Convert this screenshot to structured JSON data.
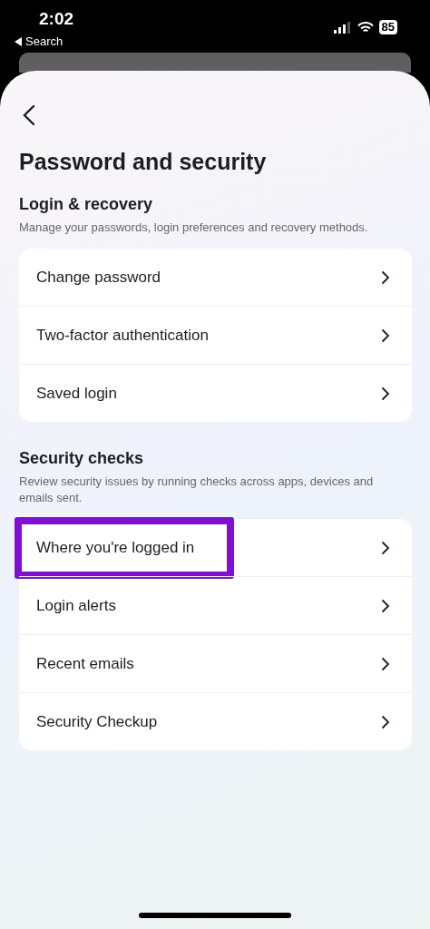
{
  "status_bar": {
    "time": "2:02",
    "back_label": "Search",
    "battery": "85"
  },
  "title": "Password and security",
  "sections": [
    {
      "heading": "Login & recovery",
      "description": "Manage your passwords, login preferences and recovery methods.",
      "items": [
        {
          "label": "Change password",
          "highlighted": false
        },
        {
          "label": "Two-factor authentication",
          "highlighted": false
        },
        {
          "label": "Saved login",
          "highlighted": false
        }
      ]
    },
    {
      "heading": "Security checks",
      "description": "Review security issues by running checks across apps, devices and emails sent.",
      "items": [
        {
          "label": "Where you're logged in",
          "highlighted": true
        },
        {
          "label": "Login alerts",
          "highlighted": false
        },
        {
          "label": "Recent emails",
          "highlighted": false
        },
        {
          "label": "Security Checkup",
          "highlighted": false
        }
      ]
    }
  ]
}
